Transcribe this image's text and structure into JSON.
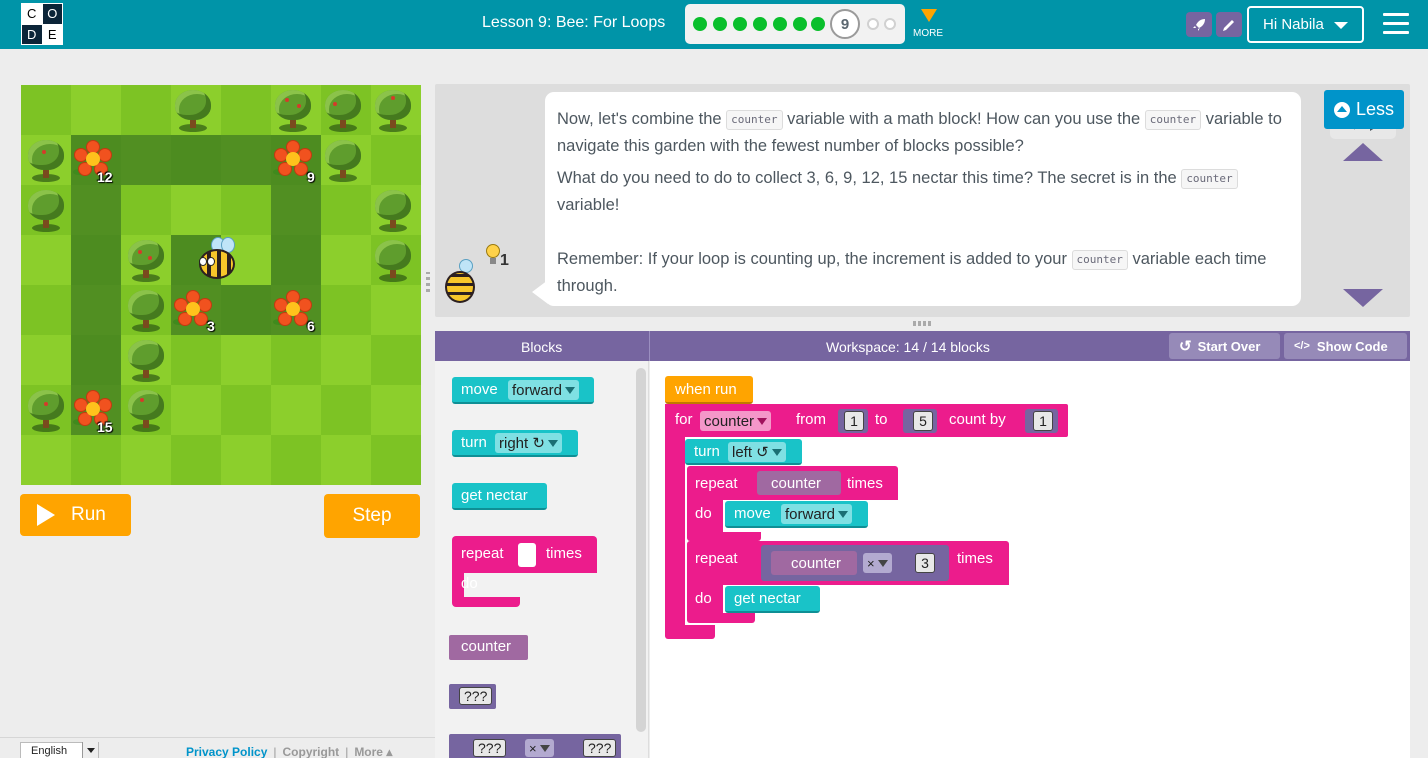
{
  "header": {
    "logo_letters": [
      "C",
      "O",
      "D",
      "E"
    ],
    "lesson_title": "Lesson 9: Bee: For Loops",
    "progress": {
      "completed": 8,
      "current": "9",
      "remaining": 2
    },
    "more_label": "MORE",
    "user_greeting": "Hi Nabila",
    "accent_color": "#0094a8"
  },
  "maze": {
    "flowers": [
      {
        "nectar": "12"
      },
      {
        "nectar": "9"
      },
      {
        "nectar": "3"
      },
      {
        "nectar": "6"
      },
      {
        "nectar": "15"
      }
    ],
    "bee_icon": "bee-character"
  },
  "controls": {
    "run_label": "Run",
    "step_label": "Step"
  },
  "footer": {
    "language": "English",
    "privacy": "Privacy Policy",
    "copyright": "Copyright",
    "more": "More ▴"
  },
  "instructions": {
    "p1_a": "Now, let's combine the ",
    "p1_code1": "counter",
    "p1_b": " variable with a math block! How can you use the ",
    "p1_code2": "counter",
    "p1_c": " variable to navigate this garden with the fewest number of blocks possible?",
    "p2_a": "What do you need to do to collect 3, 6, 9, 12, 15 nectar this time? The secret is in the ",
    "p2_code": "counter",
    "p2_b": " variable!",
    "p3_a": "Remember: If your loop is counting up, the increment is added to your ",
    "p3_code": "counter",
    "p3_b": " variable each time through.",
    "hint_count": "1",
    "less_label": "Less"
  },
  "workspace_header": {
    "toolbox_title": "Blocks",
    "workspace_title": "Workspace: 14 / 14 blocks",
    "start_over": "Start Over",
    "show_code": "Show Code",
    "start_over_icon": "↺",
    "show_code_icon": "</>"
  },
  "toolbox": {
    "move_label": "move",
    "move_dir": "forward",
    "turn_label": "turn",
    "turn_dir": "right ↻",
    "get_nectar": "get nectar",
    "repeat_label": "repeat",
    "times_label": "times",
    "do_label": "do",
    "counter_label": "counter",
    "unknown": "???",
    "times_op": "×"
  },
  "program": {
    "when_run": "when run",
    "for_label": "for",
    "for_var": "counter",
    "from_label": "from",
    "from_val": "1",
    "to_label": "to",
    "to_val": "5",
    "count_by_label": "count by",
    "count_by_val": "1",
    "turn_label": "turn",
    "turn_dir": "left ↺",
    "repeat1_label": "repeat",
    "repeat1_var": "counter",
    "repeat1_times": "times",
    "repeat1_do": "do",
    "move_label": "move",
    "move_dir": "forward",
    "repeat2_label": "repeat",
    "repeat2_var": "counter",
    "repeat2_op": "×",
    "repeat2_val": "3",
    "repeat2_times": "times",
    "repeat2_do": "do",
    "get_nectar": "get nectar"
  }
}
